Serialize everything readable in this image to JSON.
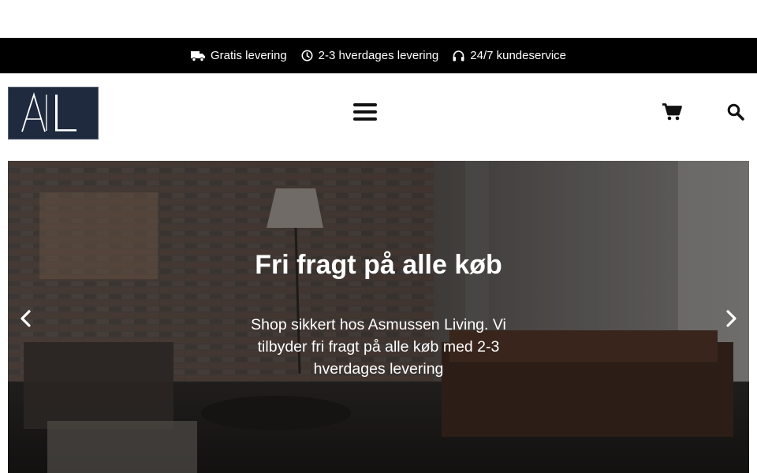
{
  "info_bar": {
    "items": [
      {
        "label": "Gratis levering",
        "icon": "truck-icon"
      },
      {
        "label": "2-3 hverdages levering",
        "icon": "clock-icon"
      },
      {
        "label": "24/7 kundeservice",
        "icon": "headphones-icon"
      }
    ]
  },
  "header": {
    "logo_text": "AL",
    "logo_color": "#1f2a3f",
    "menu_icon": "hamburger-menu-icon",
    "cart_icon": "cart-icon",
    "search_icon": "search-icon"
  },
  "hero": {
    "title": "Fri fragt på alle køb",
    "text": "Shop sikkert hos Asmussen Living. Vi tilbyder fri fragt på alle køb med 2-3 hverdages levering",
    "prev_icon": "chevron-left-icon",
    "next_icon": "chevron-right-icon"
  }
}
